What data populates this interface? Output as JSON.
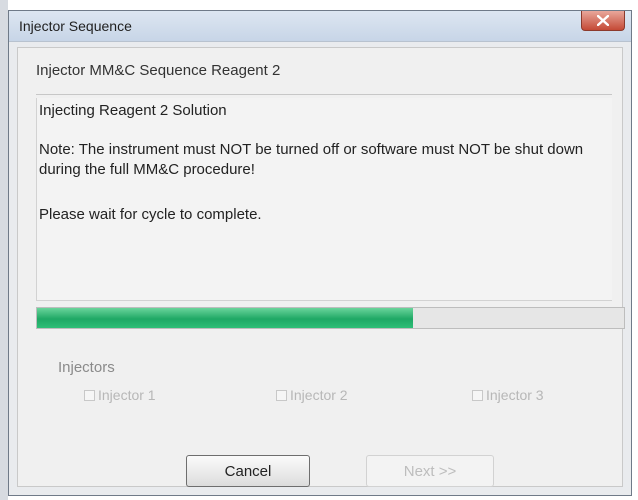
{
  "window": {
    "title": "Injector Sequence"
  },
  "dialog": {
    "heading": "Injector MM&C Sequence Reagent 2",
    "status": "Injecting Reagent 2 Solution",
    "note": "Note: The instrument must NOT be turned off or software must NOT be shut down during the full MM&C procedure!",
    "wait": "Please wait for cycle to complete."
  },
  "progress": {
    "value_percent": 64,
    "fill_color": "#1fa865"
  },
  "injectors": {
    "label": "Injectors",
    "items": [
      "Injector 1",
      "Injector 2",
      "Injector 3"
    ]
  },
  "buttons": {
    "cancel": "Cancel",
    "next": "Next >>"
  },
  "icons": {
    "close": "close-icon"
  }
}
